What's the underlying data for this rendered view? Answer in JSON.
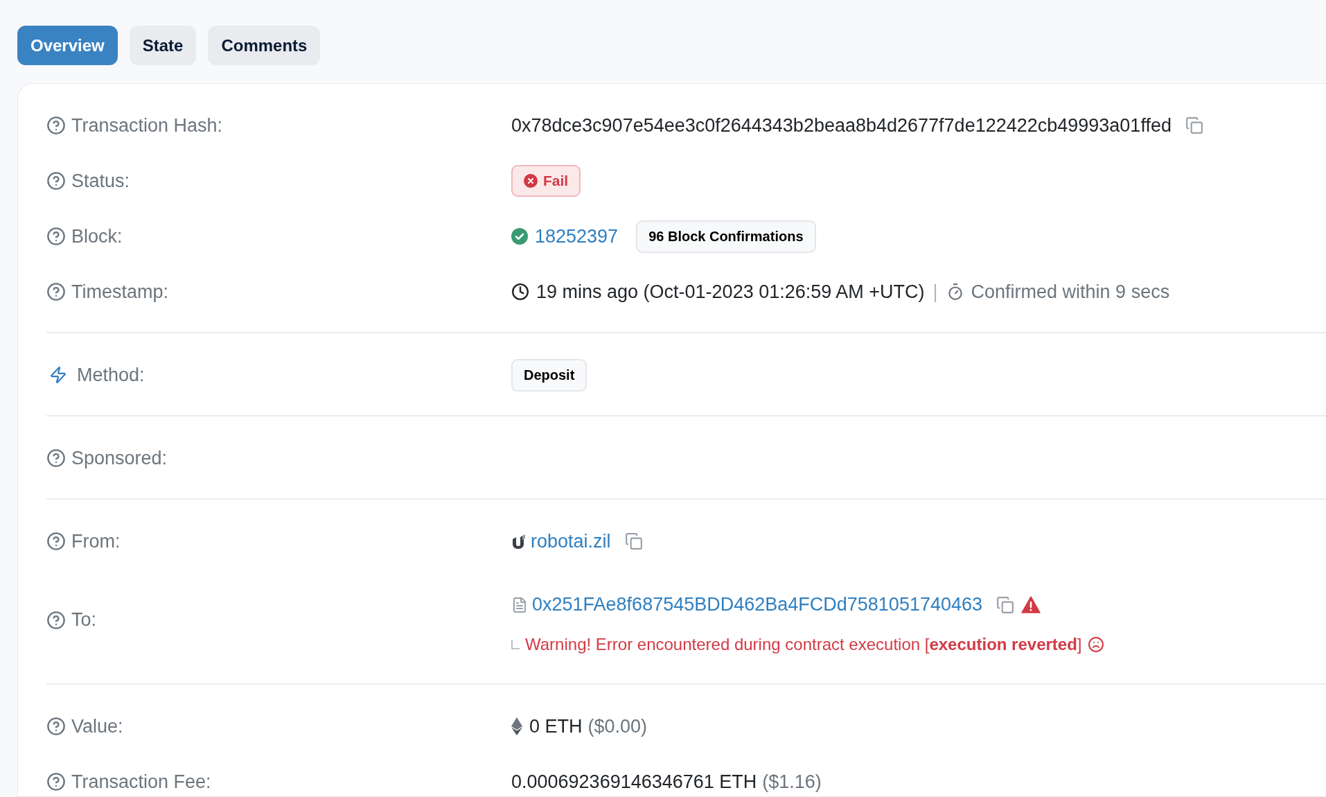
{
  "tabs": [
    {
      "label": "Overview",
      "selected": true
    },
    {
      "label": "State",
      "selected": false
    },
    {
      "label": "Comments",
      "selected": false
    }
  ],
  "sections": [
    {
      "rows": [
        {
          "kind": "hash",
          "label": "Transaction Hash:",
          "value": "0x78dce3c907e54ee3c0f2644343b2beaa8b4d2677f7de122422cb49993a01ffed",
          "copyable": true
        },
        {
          "kind": "status",
          "label": "Status:",
          "status": "Fail"
        },
        {
          "kind": "block",
          "label": "Block:",
          "number": "18252397",
          "confirmations": "96 Block Confirmations"
        },
        {
          "kind": "timestamp",
          "label": "Timestamp:",
          "time": "19 mins ago (Oct-01-2023 01:26:59 AM +UTC)",
          "separator": "|",
          "confirmed": "Confirmed within 9 secs"
        }
      ]
    },
    {
      "rows": [
        {
          "kind": "method",
          "label": "Method:",
          "method": "Deposit"
        }
      ]
    },
    {
      "rows": [
        {
          "kind": "empty",
          "label": "Sponsored:"
        }
      ]
    },
    {
      "rows": [
        {
          "kind": "name_address",
          "label": "From:",
          "address": "robotai.zil",
          "copyable": true,
          "flagged": false
        },
        {
          "kind": "contract_address",
          "label": "To:",
          "address": "0x251FAe8f687545BDD462Ba4FCDd7581051740463",
          "copyable": true,
          "flagged": true,
          "warning": "Warning! Error encountered during contract execution [**execution reverted**]"
        }
      ]
    },
    {
      "rows": [
        {
          "kind": "amount",
          "label": "Value:",
          "eth_icon": true,
          "amount": "0 ETH",
          "fiat": "($0.00)"
        },
        {
          "kind": "amount",
          "label": "Transaction Fee:",
          "eth_icon": false,
          "amount": "0.000692369146346761 ETH",
          "fiat": "($1.16)"
        }
      ]
    }
  ]
}
